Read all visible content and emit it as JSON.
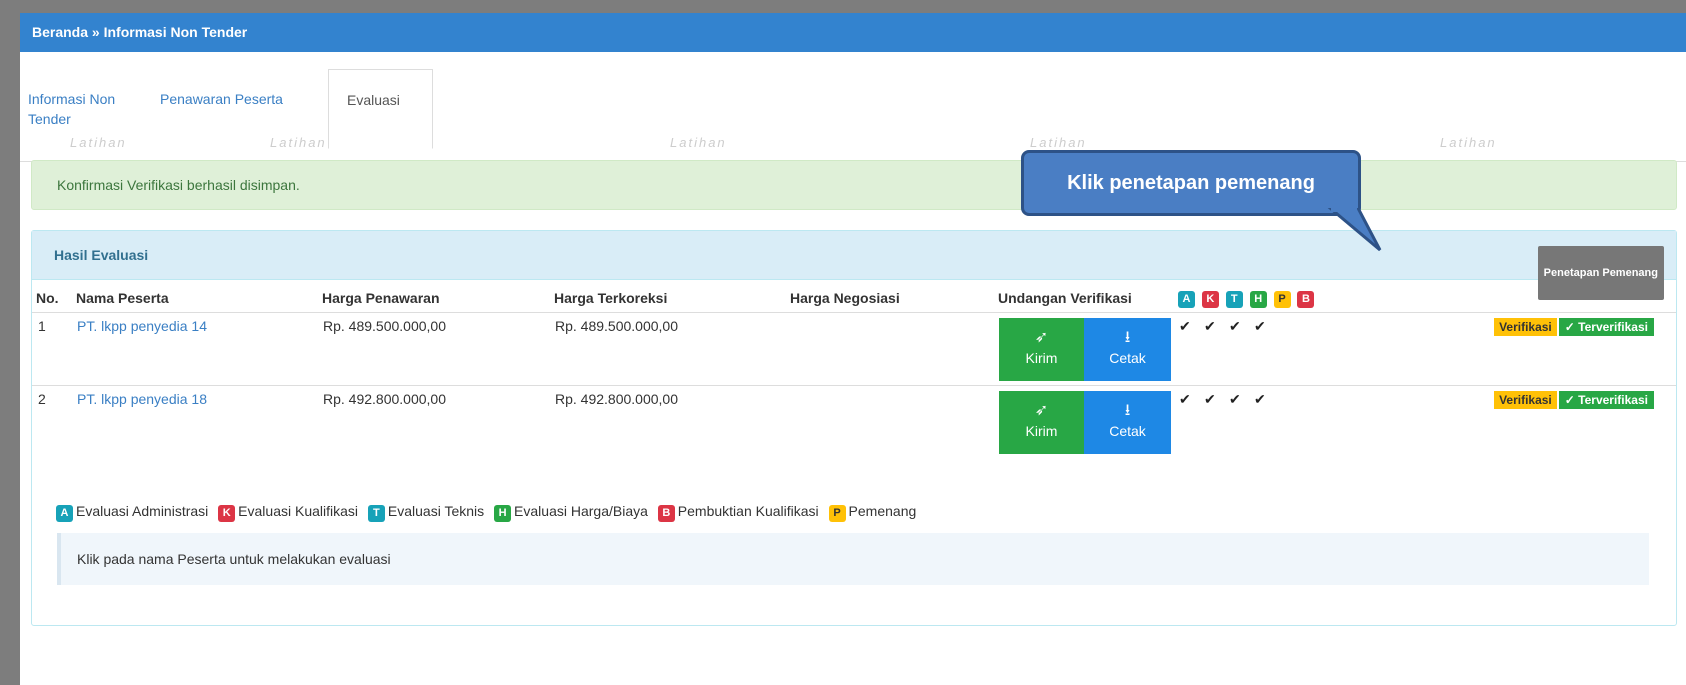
{
  "breadcrumb": "Beranda » Informasi Non Tender",
  "tabs": [
    {
      "label": "Informasi Non Tender"
    },
    {
      "label": "Penawaran Peserta"
    },
    {
      "label": "Evaluasi"
    }
  ],
  "watermark": "Latihan",
  "alert": "Konfirmasi Verifikasi berhasil disimpan.",
  "callout": "Klik penetapan pemenang",
  "panel": {
    "title": "Hasil Evaluasi",
    "action_button": "Penetapan Pemenang"
  },
  "table": {
    "headers": [
      "No.",
      "Nama Peserta",
      "Harga Penawaran",
      "Harga Terkoreksi",
      "Harga Negosiasi",
      "Undangan Verifikasi"
    ],
    "badges": [
      "A",
      "K",
      "T",
      "H",
      "P",
      "B"
    ],
    "rows": [
      {
        "no": "1",
        "nama": "PT. lkpp penyedia 14",
        "penawaran": "Rp. 489.500.000,00",
        "terkoreksi": "Rp. 489.500.000,00",
        "negosiasi": "",
        "kirim": "Kirim",
        "cetak": "Cetak",
        "checks": [
          "✔",
          "✔",
          "✔",
          "✔"
        ],
        "verifikasi": "Verifikasi",
        "status": "✓ Terverifikasi"
      },
      {
        "no": "2",
        "nama": "PT. lkpp penyedia 18",
        "penawaran": "Rp. 492.800.000,00",
        "terkoreksi": "Rp. 492.800.000,00",
        "negosiasi": "",
        "kirim": "Kirim",
        "cetak": "Cetak",
        "checks": [
          "✔",
          "✔",
          "✔",
          "✔"
        ],
        "verifikasi": "Verifikasi",
        "status": "✓ Terverifikasi"
      }
    ]
  },
  "legend": [
    {
      "badge": "A",
      "label": "Evaluasi Administrasi"
    },
    {
      "badge": "K",
      "label": "Evaluasi Kualifikasi"
    },
    {
      "badge": "T",
      "label": "Evaluasi Teknis"
    },
    {
      "badge": "H",
      "label": "Evaluasi Harga/Biaya"
    },
    {
      "badge": "B",
      "label": "Pembuktian Kualifikasi"
    },
    {
      "badge": "P",
      "label": "Pemenang"
    }
  ],
  "hint": "Klik pada nama Peserta untuk melakukan evaluasi",
  "icons": {
    "kirim": "paper-plane-icon",
    "cetak": "download-icon",
    "check": "check-icon"
  },
  "colors": {
    "topbar": "#3383cf",
    "success": "#28a745",
    "primary": "#1e88e5",
    "warning": "#ffc107",
    "danger": "#dc3545",
    "info": "#17a2b8"
  }
}
